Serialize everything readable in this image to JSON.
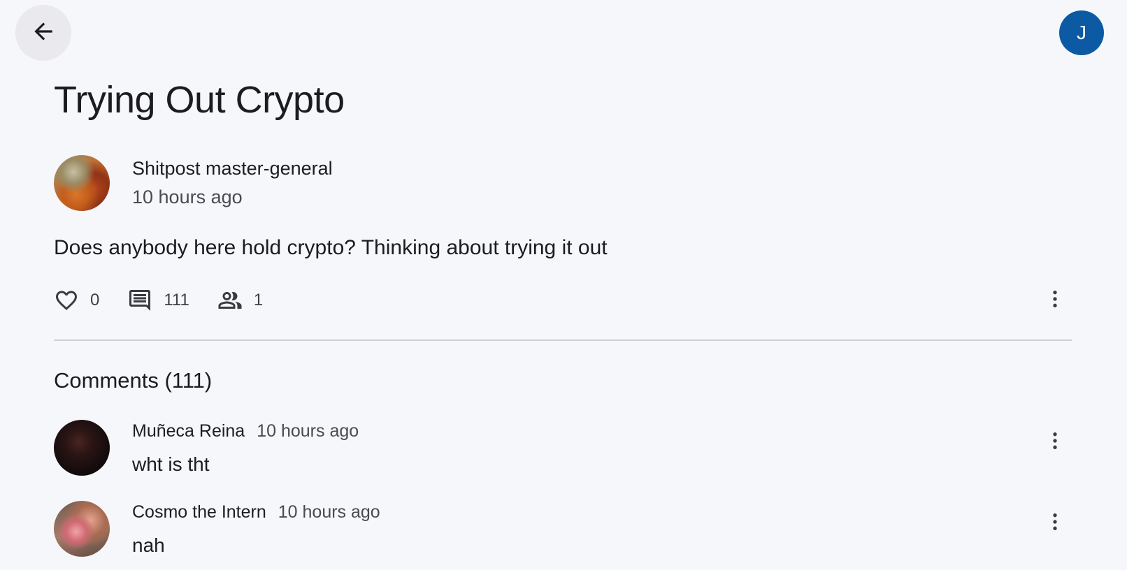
{
  "header": {
    "back_icon": "arrow-left-icon",
    "user_initial": "J",
    "user_avatar_color": "#0b5aa3"
  },
  "post": {
    "title": "Trying Out Crypto",
    "author": "Shitpost master-general",
    "time": "10 hours ago",
    "body": "Does anybody here hold crypto? Thinking about trying it out",
    "likes": "0",
    "comments_count": "111",
    "participants": "1",
    "icons": {
      "like": "heart-outline-icon",
      "comments": "comment-icon",
      "participants": "people-icon",
      "more": "more-vertical-icon"
    }
  },
  "comments_section": {
    "heading": "Comments (111)",
    "items": [
      {
        "author": "Muñeca Reina",
        "time": "10 hours ago",
        "text": "wht is tht"
      },
      {
        "author": "Cosmo the Intern",
        "time": "10 hours ago",
        "text": "nah"
      }
    ]
  }
}
